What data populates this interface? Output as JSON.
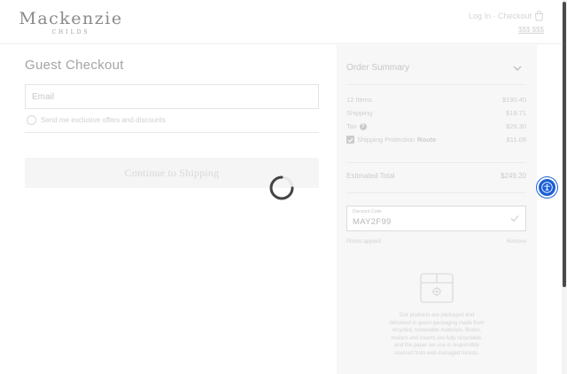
{
  "header": {
    "logo_main": "Mackenzie",
    "logo_sub": "CHILDS",
    "links": "Log In · Checkout",
    "subtotal": "$$$ $$$"
  },
  "checkout": {
    "title": "Guest Checkout",
    "email_placeholder": "Email",
    "newsletter": "Send me exclusive offers and discounts",
    "continue_label": "Continue to Shipping"
  },
  "summary": {
    "title": "Order Summary",
    "items": [
      {
        "label": "12 Items",
        "value": "$190.40"
      },
      {
        "label": "Shipping",
        "value": "$19.71"
      },
      {
        "label": "Tax",
        "value": "$29.30"
      },
      {
        "label": "Shipping Protection",
        "route_label": "Route",
        "value": "$11.08"
      }
    ],
    "estimated_total_label": "Estimated Total",
    "estimated_total_value": "$249.20",
    "promo_label": "Discount Code",
    "promo_code": "MAY2F99",
    "applied_label": "Promo applied",
    "applied_action": "Remove",
    "green_message": "Our products are packaged and delivered in green packaging made from recycled, renewable materials. Boxes, mailers and inserts are fully recyclable, and the paper we use is responsibly sourced from well-managed forests."
  },
  "colors": {
    "accessibility": "#1a5fd6",
    "scroll_thumb": "#4a4a4a"
  },
  "icons": [
    "bag-icon",
    "chevron-down-icon",
    "question-icon",
    "checkbox-icon",
    "check-icon",
    "box-icon",
    "spinner-icon",
    "accessibility-icon"
  ]
}
